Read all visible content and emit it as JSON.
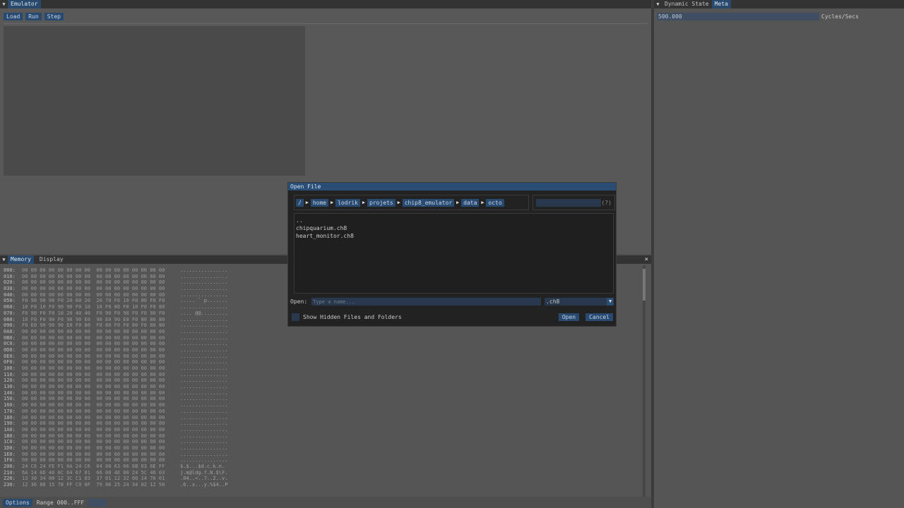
{
  "emulator": {
    "title": "Emulator",
    "toolbar": [
      "Load",
      "Run",
      "Step"
    ]
  },
  "dynamic_state": {
    "tabs": [
      "Dynamic State",
      "Meta"
    ],
    "active_tab": "Meta",
    "cycles_value": "500.000",
    "cycles_label": "Cycles/Secs"
  },
  "memory": {
    "tabs": [
      "Memory",
      "Display"
    ],
    "active_tab": "Memory",
    "close_glyph": "×",
    "rows": [
      [
        "000:",
        "00 00 00 00 00 00 00 00  00 00 00 00 00 00 00 00",
        "................"
      ],
      [
        "010:",
        "00 00 00 00 00 00 00 00  00 00 00 00 00 00 00 00",
        "................"
      ],
      [
        "020:",
        "00 00 00 00 00 00 00 00  00 00 00 00 00 00 00 00",
        "................"
      ],
      [
        "030:",
        "00 00 00 00 00 00 00 00  00 00 00 00 00 00 00 00",
        "................"
      ],
      [
        "040:",
        "00 00 00 00 00 00 00 00  00 00 00 00 00 00 00 00",
        "................"
      ],
      [
        "050:",
        "F0 90 90 90 F0 20 60 20  20 70 F0 10 F0 80 F0 F0",
        "..... ` p......."
      ],
      [
        "060:",
        "10 F0 10 F0 90 90 F0 10  10 F0 80 F0 10 F0 F0 80",
        "................"
      ],
      [
        "070:",
        "F0 90 F0 F0 10 20 40 40  F0 90 F0 90 F0 F0 90 F0",
        ".... @@........."
      ],
      [
        "080:",
        "10 F0 F0 90 F0 90 90 E0  90 E0 90 E0 F0 80 80 80",
        "................"
      ],
      [
        "090:",
        "F0 E0 90 90 90 E0 F0 80  F0 80 F0 F0 80 F0 80 80",
        "................"
      ],
      [
        "0A0:",
        "00 00 00 00 00 00 00 00  00 00 00 00 00 00 00 00",
        "................"
      ],
      [
        "0B0:",
        "00 00 00 00 00 00 00 00  00 00 00 00 00 00 00 00",
        "................"
      ],
      [
        "0C0:",
        "00 00 00 00 00 00 00 00  00 00 00 00 00 00 00 00",
        "................"
      ],
      [
        "0D0:",
        "00 00 00 00 00 00 00 00  00 00 00 00 00 00 00 00",
        "................"
      ],
      [
        "0E0:",
        "00 00 00 00 00 00 00 00  00 00 00 00 00 00 00 00",
        "................"
      ],
      [
        "0F0:",
        "00 00 00 00 00 00 00 00  00 00 00 00 00 00 00 00",
        "................"
      ],
      [
        "100:",
        "00 00 00 00 00 00 00 00  00 00 00 00 00 00 00 00",
        "................"
      ],
      [
        "110:",
        "00 00 00 00 00 00 00 00  00 00 00 00 00 00 00 00",
        "................"
      ],
      [
        "120:",
        "00 00 00 00 00 00 00 00  00 00 00 00 00 00 00 00",
        "................"
      ],
      [
        "130:",
        "00 00 00 00 00 00 00 00  00 00 00 00 00 00 00 00",
        "................"
      ],
      [
        "140:",
        "00 00 00 00 00 00 00 00  00 00 00 00 00 00 00 00",
        "................"
      ],
      [
        "150:",
        "00 00 00 00 00 00 00 00  00 00 00 00 00 00 00 00",
        "................"
      ],
      [
        "160:",
        "00 00 00 00 00 00 00 00  00 00 00 00 00 00 00 00",
        "................"
      ],
      [
        "170:",
        "00 00 00 00 00 00 00 00  00 00 00 00 00 00 00 00",
        "................"
      ],
      [
        "180:",
        "00 00 00 00 00 00 00 00  00 00 00 00 00 00 00 00",
        "................"
      ],
      [
        "190:",
        "00 00 00 00 00 00 00 00  00 00 00 00 00 00 00 00",
        "................"
      ],
      [
        "1A0:",
        "00 00 00 00 00 00 00 00  00 00 00 00 00 00 00 00",
        "................"
      ],
      [
        "1B0:",
        "00 00 00 00 00 00 00 00  00 00 00 00 00 00 00 00",
        "................"
      ],
      [
        "1C0:",
        "00 00 00 00 00 00 00 00  00 00 00 00 00 00 00 00",
        "................"
      ],
      [
        "1D0:",
        "00 00 00 00 00 00 00 00  00 00 00 00 00 00 00 00",
        "................"
      ],
      [
        "1E0:",
        "00 00 00 00 00 00 00 00  00 00 00 00 00 00 00 00",
        "................"
      ],
      [
        "1F0:",
        "00 00 00 00 00 00 00 00  00 00 00 00 00 00 00 00",
        "................"
      ],
      [
        "200:",
        "24 C6 24 FE F1 6A 24 C6  64 00 63 06 6B 03 6E FF",
        "$.$...$d.c.k.n."
      ],
      [
        "210:",
        "6A 14 6D 40 6C 64 67 01  66 00 4E 00 24 5C 46 03",
        "j.m@ldg.f.N.$\\F."
      ],
      [
        "220:",
        "13 30 34 00 12 3C C1 03  37 01 12 32 00 14 76 01",
        ".04..<..7..2..v."
      ],
      [
        "230:",
        "12 36 88 15 78 FF C9 0F  79 06 25 24 34 02 12 50",
        ".6..x...y.%$4..P"
      ]
    ],
    "footer": {
      "options_label": "Options",
      "range_label": "Range 000..FFF"
    }
  },
  "open_file_dialog": {
    "title": "Open File",
    "breadcrumb": [
      "/",
      "home",
      "lodrik",
      "projets",
      "chip8_emulator",
      "data",
      "octo"
    ],
    "search_help": "(?)",
    "files": [
      "..",
      "chipquarium.ch8",
      "heart_monitor.ch8"
    ],
    "open_label": "Open:",
    "name_placeholder": "Type a name...",
    "filter_value": ".ch8",
    "show_hidden_label": "Show Hidden Files and Folders",
    "open_button": "Open",
    "cancel_button": "Cancel"
  }
}
